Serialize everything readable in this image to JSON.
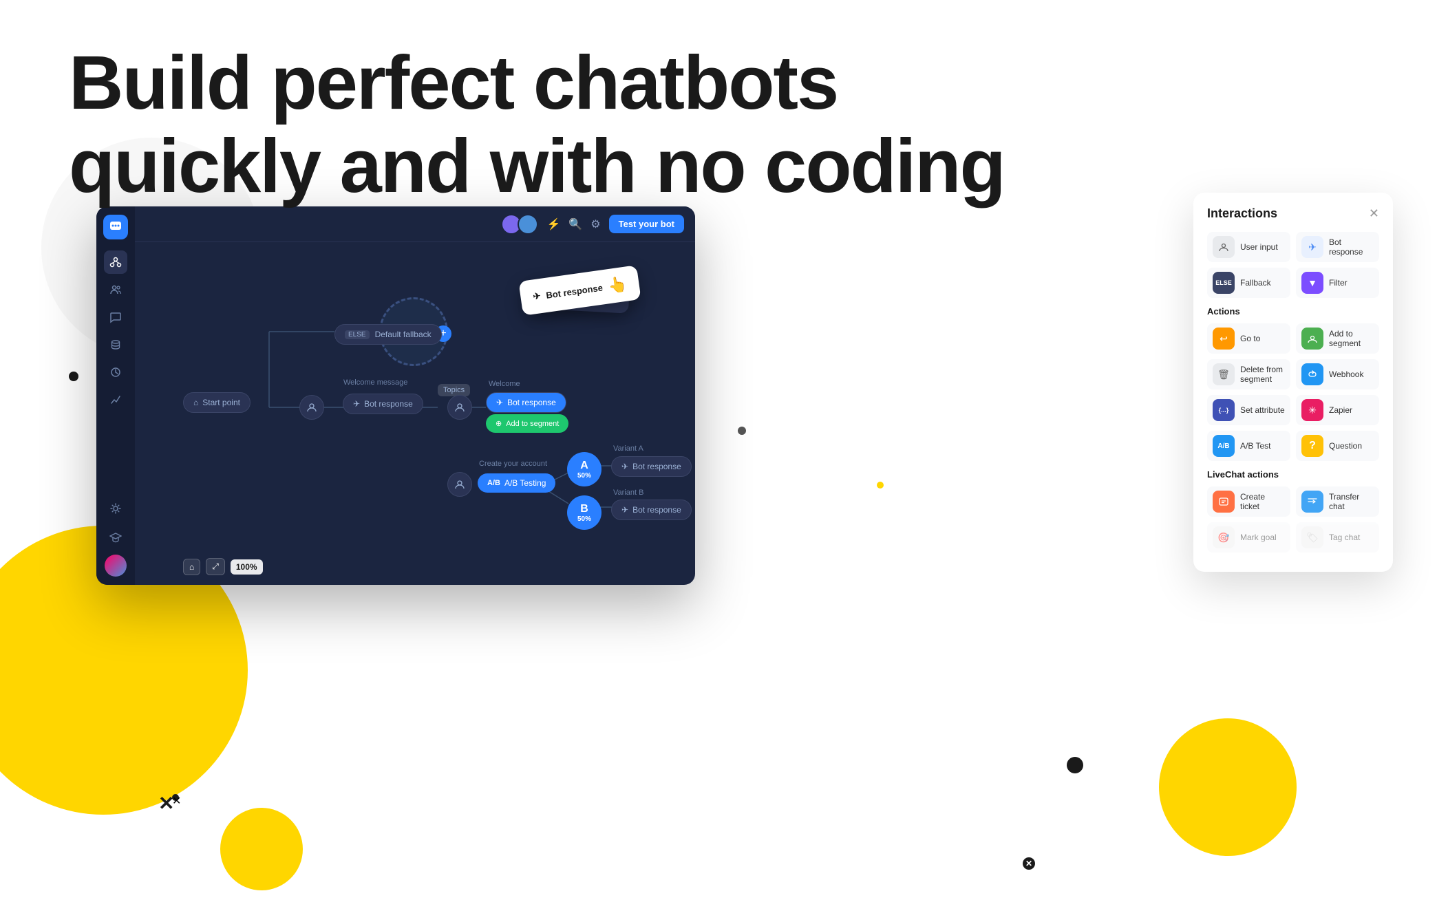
{
  "heading": {
    "line1": "Build perfect chatbots",
    "line2": "quickly and with no coding"
  },
  "sidebar": {
    "logo_icon": "💬",
    "items": [
      {
        "name": "flows",
        "icon": "⬡",
        "active": true
      },
      {
        "name": "users",
        "icon": "👥"
      },
      {
        "name": "chat",
        "icon": "💬"
      },
      {
        "name": "database",
        "icon": "🗄"
      },
      {
        "name": "clock",
        "icon": "🕐"
      },
      {
        "name": "analytics",
        "icon": "📈"
      },
      {
        "name": "integrations",
        "icon": "⚙"
      }
    ]
  },
  "topbar": {
    "test_btn_label": "Test your bot",
    "zoom_level": "100%"
  },
  "canvas": {
    "nodes": {
      "start": "Start point",
      "welcome_message_label": "Welcome message",
      "bot_response_1": "Bot response",
      "bot_response_2": "Bot response",
      "bot_response_variant_a": "Bot response",
      "bot_response_variant_b": "Bot response",
      "add_to_segment": "Add to segment",
      "ab_testing": "A/B Testing",
      "fallback": "Default fallback",
      "topics_label": "Topics",
      "welcome_label": "Welcome",
      "create_account_label": "Create your account",
      "variant_a_label": "Variant A",
      "variant_b_label": "Variant B",
      "variant_a_pct": "50%",
      "variant_b_pct": "50%",
      "variant_a_letter": "A",
      "variant_b_letter": "B"
    }
  },
  "floating_card": {
    "label": "Bot response"
  },
  "toolbar": {
    "home_icon": "⌂",
    "expand_icon": "⤢",
    "zoom": "100%"
  },
  "interactions_panel": {
    "title": "Interactions",
    "close_label": "✕",
    "sections": [
      {
        "title": "",
        "items": [
          {
            "label": "User input",
            "icon": "👤",
            "icon_class": "icon-gray"
          },
          {
            "label": "Bot response",
            "icon": "✈",
            "icon_class": "icon-blue-light"
          },
          {
            "label": "Fallback",
            "icon": "ELSE",
            "icon_class": "icon-dark",
            "is_text": true
          },
          {
            "label": "Filter",
            "icon": "▼",
            "icon_class": "icon-purple"
          }
        ]
      },
      {
        "title": "Actions",
        "items": [
          {
            "label": "Go to",
            "icon": "↩",
            "icon_class": "icon-orange"
          },
          {
            "label": "Add to segment",
            "icon": "👤",
            "icon_class": "icon-green"
          },
          {
            "label": "Delete from segment",
            "icon": "🗑",
            "icon_class": "icon-gray"
          },
          {
            "label": "Webhook",
            "icon": "⚡",
            "icon_class": "icon-blue"
          },
          {
            "label": "Set attribute",
            "icon": "{...}",
            "icon_class": "icon-indigo",
            "is_text": true
          },
          {
            "label": "Zapier",
            "icon": "✳",
            "icon_class": "icon-pink"
          },
          {
            "label": "A/B Test",
            "icon": "A/B",
            "icon_class": "icon-blue",
            "is_text": true
          },
          {
            "label": "Question",
            "icon": "?",
            "icon_class": "icon-yellow",
            "is_text": true
          }
        ]
      },
      {
        "title": "LiveChat actions",
        "items": [
          {
            "label": "Create ticket",
            "icon": "🎫",
            "icon_class": "icon-chat-orange"
          },
          {
            "label": "Transfer chat",
            "icon": "↗",
            "icon_class": "icon-chat-blue"
          },
          {
            "label": "Mark goal",
            "icon": "🎯",
            "icon_class": "icon-disabled"
          },
          {
            "label": "Tag chat",
            "icon": "🏷",
            "icon_class": "icon-disabled"
          }
        ]
      }
    ]
  }
}
